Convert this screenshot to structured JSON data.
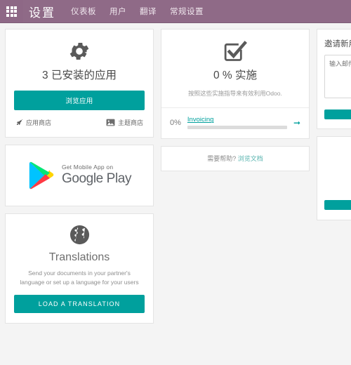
{
  "topbar": {
    "apps_icon": "grid-apps-icon",
    "brand": "设置",
    "menu": [
      {
        "label": "仪表板"
      },
      {
        "label": "用户"
      },
      {
        "label": "翻译"
      },
      {
        "label": "常规设置"
      }
    ],
    "bg_color": "#8f6a87"
  },
  "accent_color": "#00a09d",
  "apps_card": {
    "icon": "gear-icon",
    "title": "3 已安装的应用",
    "browse_button": "浏览应用",
    "links": [
      {
        "icon": "rocket-icon",
        "label": "应用商店"
      },
      {
        "icon": "image-icon",
        "label": "主题商店"
      }
    ]
  },
  "google_play_card": {
    "icon": "google-play-icon",
    "small_text": "Get Mobile App on",
    "big_text": "Google Play"
  },
  "translations_card": {
    "icon": "globe-icon",
    "title": "Translations",
    "description": "Send your documents in your partner's language or set up a language for your users",
    "button": "LOAD A TRANSLATION"
  },
  "implementation_card": {
    "icon": "checkbox-checked-icon",
    "title": "0 % 实施",
    "subtitle": "按照这些实施指导来有效利用Odoo.",
    "progress": {
      "percent_label": "0%",
      "percent_value": 0,
      "label": "Invoicing",
      "arrow_icon": "arrow-right-icon"
    },
    "help_prefix": "需要帮助?",
    "help_link": "浏览文档"
  },
  "invite_card": {
    "title": "邀请新用户",
    "input_placeholder": "输入邮件",
    "input_value": "",
    "button": ""
  },
  "extra_card": {
    "button": ""
  }
}
